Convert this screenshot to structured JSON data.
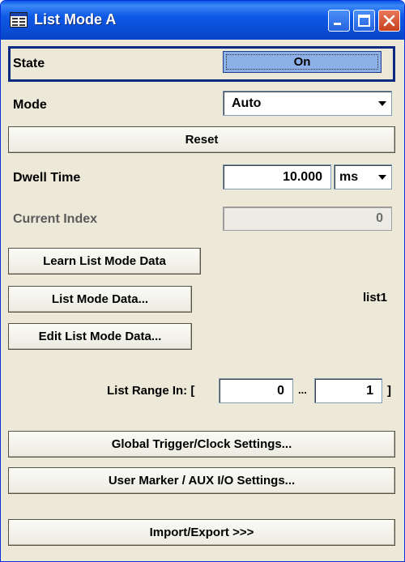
{
  "window": {
    "title": "List Mode  A"
  },
  "state": {
    "label": "State",
    "value": "On"
  },
  "mode": {
    "label": "Mode",
    "value": "Auto"
  },
  "reset": {
    "label": "Reset"
  },
  "dwell_time": {
    "label": "Dwell Time",
    "value": "10.000",
    "unit": "ms"
  },
  "current_index": {
    "label": "Current Index",
    "value": "0"
  },
  "buttons": {
    "learn": "Learn List Mode Data",
    "list_data": "List Mode Data...",
    "edit": "Edit List Mode Data...",
    "global_trigger": "Global Trigger/Clock Settings...",
    "user_marker": "User Marker / AUX I/O Settings...",
    "import_export": "Import/Export >>>"
  },
  "list_file": "list1",
  "list_range": {
    "label": "List Range In: [",
    "start": "0",
    "separator": "...",
    "stop": "1",
    "close": "]"
  },
  "colors": {
    "title_bar": "#0a55e8",
    "state_border": "#0d2a82",
    "toggle_on": "#8db0e8",
    "panel": "#ece9d8"
  },
  "icons": {
    "window_icon": "dialog-icon",
    "minimize": "minimize-icon",
    "maximize": "maximize-icon",
    "close": "close-icon"
  }
}
